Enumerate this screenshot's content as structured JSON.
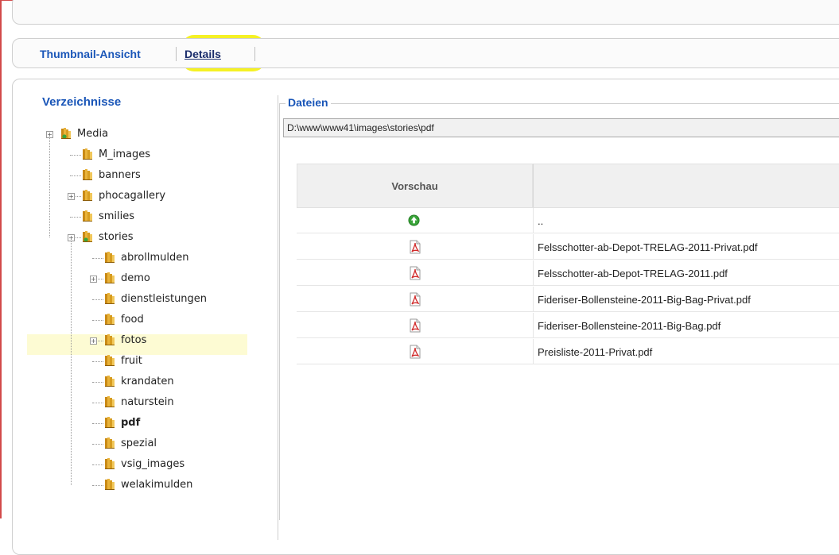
{
  "tabs": {
    "thumbnail": "Thumbnail-Ansicht",
    "details": "Details"
  },
  "directories": {
    "title": "Verzeichnisse",
    "items": [
      {
        "label": "Media",
        "depth": 0,
        "expander": true
      },
      {
        "label": "M_images",
        "depth": 1,
        "expander": false
      },
      {
        "label": "banners",
        "depth": 1,
        "expander": false
      },
      {
        "label": "phocagallery",
        "depth": 1,
        "expander": true
      },
      {
        "label": "smilies",
        "depth": 1,
        "expander": false
      },
      {
        "label": "stories",
        "depth": 1,
        "expander": true
      },
      {
        "label": "abrollmulden",
        "depth": 2,
        "expander": false
      },
      {
        "label": "demo",
        "depth": 2,
        "expander": true
      },
      {
        "label": "dienstleistungen",
        "depth": 2,
        "expander": false
      },
      {
        "label": "food",
        "depth": 2,
        "expander": false
      },
      {
        "label": "fotos",
        "depth": 2,
        "expander": true
      },
      {
        "label": "fruit",
        "depth": 2,
        "expander": false
      },
      {
        "label": "krandaten",
        "depth": 2,
        "expander": false
      },
      {
        "label": "naturstein",
        "depth": 2,
        "expander": false
      },
      {
        "label": "pdf",
        "depth": 2,
        "expander": false,
        "selected": true
      },
      {
        "label": "spezial",
        "depth": 2,
        "expander": false
      },
      {
        "label": "vsig_images",
        "depth": 2,
        "expander": false
      },
      {
        "label": "welakimulden",
        "depth": 2,
        "expander": false
      }
    ]
  },
  "files": {
    "legend": "Dateien",
    "path": "D:\\www\\www41\\images\\stories\\pdf",
    "header_preview": "Vorschau",
    "rows": [
      {
        "name": "..",
        "icon": "up-arrow-icon"
      },
      {
        "name": "Felsschotter-ab-Depot-TRELAG-2011-Privat.pdf",
        "icon": "pdf-icon"
      },
      {
        "name": "Felsschotter-ab-Depot-TRELAG-2011.pdf",
        "icon": "pdf-icon"
      },
      {
        "name": "Fideriser-Bollensteine-2011-Big-Bag-Privat.pdf",
        "icon": "pdf-icon"
      },
      {
        "name": "Fideriser-Bollensteine-2011-Big-Bag.pdf",
        "icon": "pdf-icon"
      },
      {
        "name": "Preisliste-2011-Privat.pdf",
        "icon": "pdf-icon"
      }
    ]
  },
  "colors": {
    "accent": "#1a56b8",
    "highlight": "#f4f00c",
    "selected_row": "#fdfbd3",
    "left_border": "#d24a4a"
  }
}
